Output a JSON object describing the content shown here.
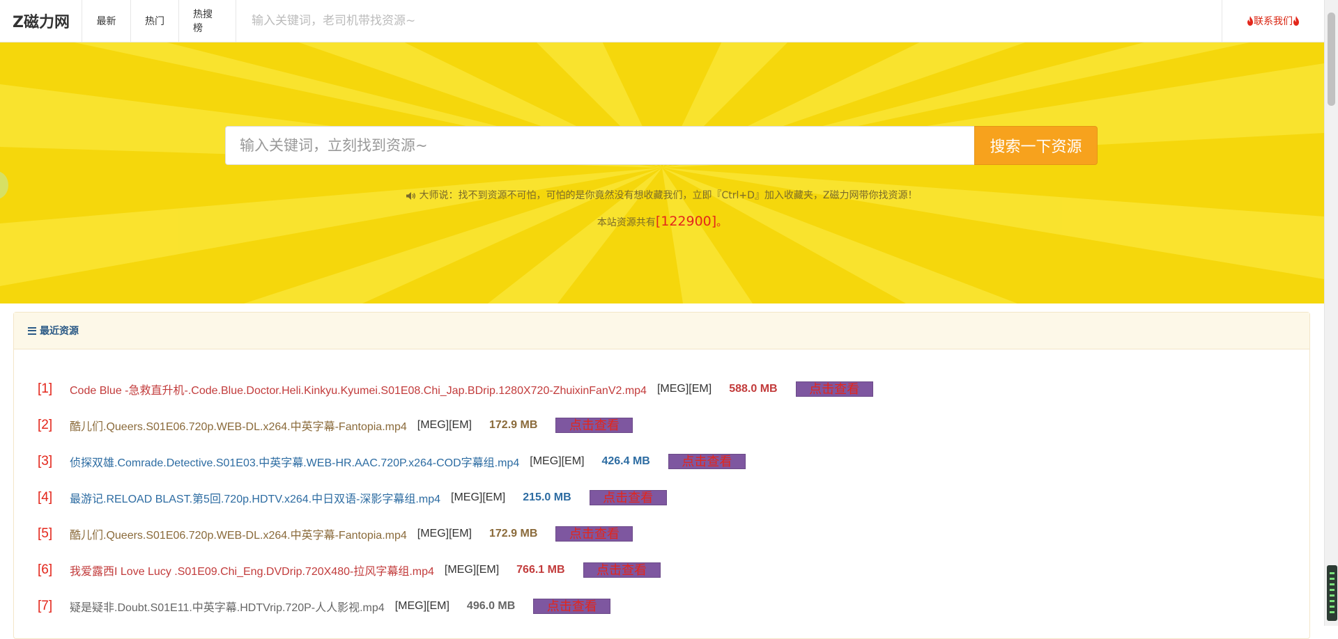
{
  "nav": {
    "brand": "Z磁力网",
    "items": [
      "最新",
      "热门",
      "热搜榜"
    ],
    "search_placeholder": "输入关键词，老司机带找资源~",
    "contact": "联系我们"
  },
  "hero": {
    "search_placeholder": "输入关键词，立刻找到资源~",
    "search_button": "搜索一下资源",
    "notice": "大师说：找不到资源不可怕，可怕的是你竟然没有想收藏我们，立即『Ctrl+D』加入收藏夹，Z磁力网带你找资源！",
    "count_prefix": "本站资源共有",
    "count_value": "[122900]",
    "count_suffix": "。"
  },
  "recent": {
    "title": "最近资源",
    "items": [
      {
        "index": "[1]",
        "title": "Code Blue -急救直升机-.Code.Blue.Doctor.Heli.Kinkyu.Kyumei.S01E08.Chi_Jap.BDrip.1280X720-ZhuixinFanV2.mp4",
        "tag": "[MEG][EM]",
        "size": "588.0 MB",
        "view": "点击查看",
        "color": "#c23b3b"
      },
      {
        "index": "[2]",
        "title": "酷儿们.Queers.S01E06.720p.WEB-DL.x264.中英字幕-Fantopia.mp4",
        "tag": "[MEG][EM]",
        "size": "172.9 MB",
        "view": "点击查看",
        "color": "#8a6a3a"
      },
      {
        "index": "[3]",
        "title": "侦探双雄.Comrade.Detective.S01E03.中英字幕.WEB-HR.AAC.720P.x264-COD字幕组.mp4",
        "tag": "[MEG][EM]",
        "size": "426.4 MB",
        "view": "点击查看",
        "color": "#2d6ca2"
      },
      {
        "index": "[4]",
        "title": "最游记.RELOAD BLAST.第5回.720p.HDTV.x264.中日双语-深影字幕组.mp4",
        "tag": "[MEG][EM]",
        "size": "215.0 MB",
        "view": "点击查看",
        "color": "#2d6ca2"
      },
      {
        "index": "[5]",
        "title": "酷儿们.Queers.S01E06.720p.WEB-DL.x264.中英字幕-Fantopia.mp4",
        "tag": "[MEG][EM]",
        "size": "172.9 MB",
        "view": "点击查看",
        "color": "#8a6a3a"
      },
      {
        "index": "[6]",
        "title": "我爱露西I Love Lucy .S01E09.Chi_Eng.DVDrip.720X480-拉风字幕组.mp4",
        "tag": "[MEG][EM]",
        "size": "766.1 MB",
        "view": "点击查看",
        "color": "#c23b3b"
      },
      {
        "index": "[7]",
        "title": "疑是疑非.Doubt.S01E11.中英字幕.HDTVrip.720P-人人影视.mp4",
        "tag": "[MEG][EM]",
        "size": "496.0 MB",
        "view": "点击查看",
        "color": "#666666"
      }
    ]
  },
  "colors": {
    "accent_orange": "#f7a21d",
    "hero_yellow": "#f5d70c",
    "link_red": "#e3261b",
    "view_button_bg": "#7e57a0"
  }
}
